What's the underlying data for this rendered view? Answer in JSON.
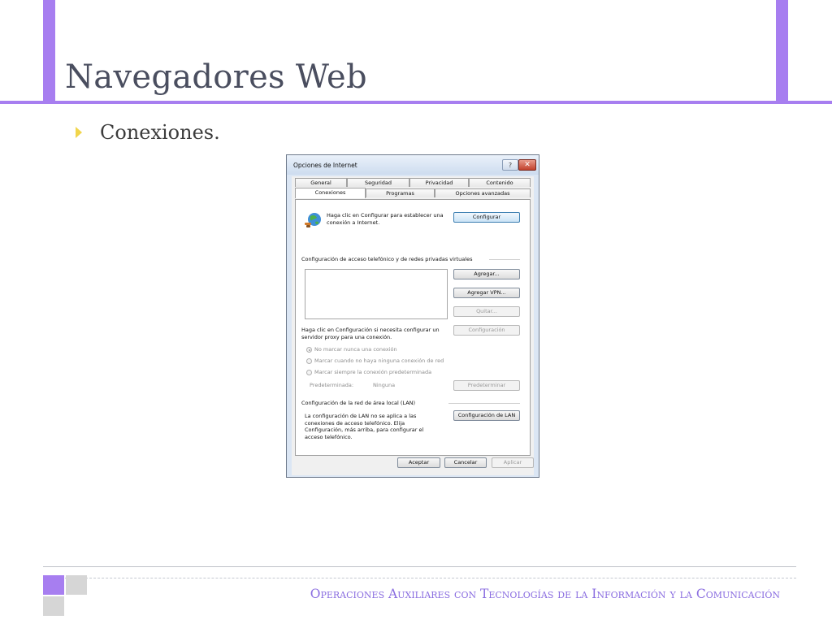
{
  "slide": {
    "title": "Navegadores Web",
    "bullet": "Conexiones.",
    "footer": "Operaciones Auxiliares con Tecnologías de la Información y la Comunicación",
    "accent_color": "#a77ef0",
    "bullet_color": "#f1d54b"
  },
  "dialog": {
    "title": "Opciones de Internet",
    "help_label": "?",
    "close_label": "✕",
    "tabs_row1": [
      "General",
      "Seguridad",
      "Privacidad",
      "Contenido"
    ],
    "tabs_row2": [
      "Conexiones",
      "Programas",
      "Opciones avanzadas"
    ],
    "active_tab": "Conexiones",
    "setup_text": "Haga clic en Configurar para establecer una conexión a Internet.",
    "setup_button": "Configurar",
    "dialup_header": "Configuración de acceso telefónico y de redes privadas virtuales",
    "add_button": "Agregar...",
    "add_vpn_button": "Agregar VPN...",
    "remove_button": "Quitar...",
    "proxy_text": "Haga clic en Configuración si necesita configurar un servidor proxy para una conexión.",
    "settings_button": "Configuración",
    "radio_options": [
      "No marcar nunca una conexión",
      "Marcar cuando no haya ninguna conexión de red",
      "Marcar siempre la conexión predeterminada"
    ],
    "default_label": "Predeterminada:",
    "default_value": "Ninguna",
    "set_default_button": "Predeterminar",
    "lan_header": "Configuración de la red de área local (LAN)",
    "lan_text": "La configuración de LAN no se aplica a las conexiones de acceso telefónico. Elija Configuración, más arriba, para configurar el acceso telefónico.",
    "lan_button": "Configuración de LAN",
    "ok_button": "Aceptar",
    "cancel_button": "Cancelar",
    "apply_button": "Aplicar"
  }
}
